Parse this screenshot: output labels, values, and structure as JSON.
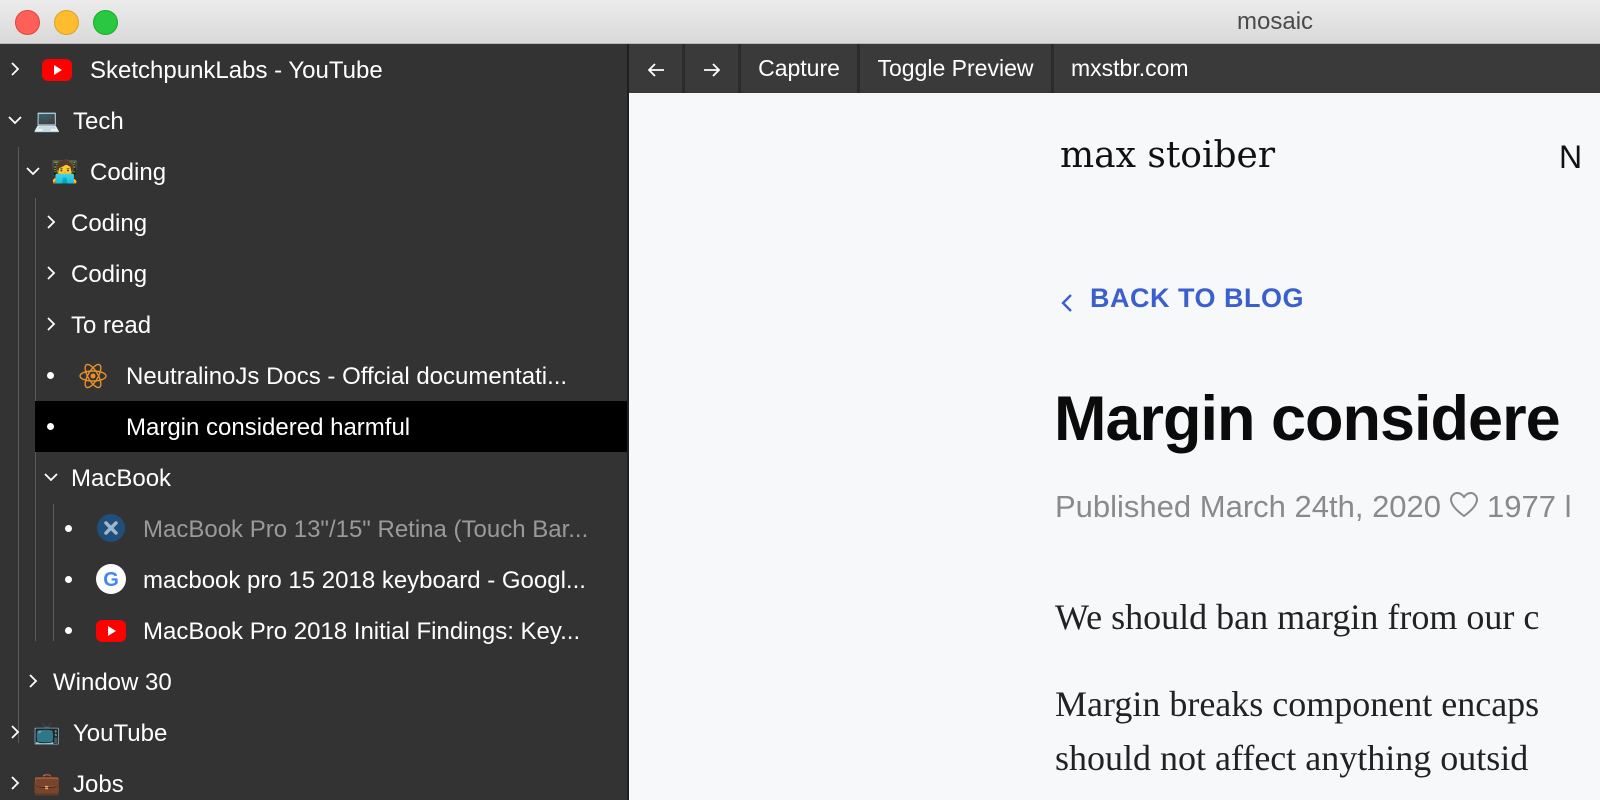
{
  "window": {
    "title": "mosaic"
  },
  "toolbar": {
    "back_icon": "arrow-left-icon",
    "forward_icon": "arrow-right-icon",
    "capture_label": "Capture",
    "toggle_preview_label": "Toggle Preview",
    "url": "mxstbr.com"
  },
  "sidebar": {
    "items": [
      {
        "label": "SketchpunkLabs - YouTube",
        "icon": "youtube-icon",
        "state": "collapsed"
      },
      {
        "label": "Tech",
        "icon": "laptop-emoji",
        "state": "expanded"
      },
      {
        "label": "Coding",
        "icon": "coder-emoji",
        "state": "expanded"
      },
      {
        "label": "Coding",
        "state": "collapsed"
      },
      {
        "label": "Coding",
        "state": "collapsed"
      },
      {
        "label": "To read",
        "state": "collapsed"
      },
      {
        "label": "NeutralinoJs Docs - Offcial documentati...",
        "icon": "atom-icon",
        "state": "leaf"
      },
      {
        "label": "Margin considered harmful",
        "state": "leaf",
        "selected": true
      },
      {
        "label": "MacBook",
        "state": "expanded"
      },
      {
        "label": "MacBook Pro 13\"/15\" Retina (Touch Bar...",
        "icon": "ifixit-icon",
        "state": "leaf",
        "dimmed": true
      },
      {
        "label": "macbook pro 15 2018 keyboard - Googl...",
        "icon": "google-icon",
        "state": "leaf"
      },
      {
        "label": "MacBook Pro 2018 Initial Findings: Key...",
        "icon": "youtube-icon",
        "state": "leaf"
      },
      {
        "label": "Window 30",
        "state": "collapsed"
      },
      {
        "label": "YouTube",
        "icon": "tv-emoji",
        "state": "collapsed"
      },
      {
        "label": "Jobs",
        "icon": "briefcase-emoji",
        "state": "collapsed"
      }
    ]
  },
  "page": {
    "brand": "max stoiber",
    "nav_partial": "N",
    "back_link": "BACK TO BLOG",
    "title": "Margin considere",
    "published": "Published March 24th, 2020",
    "likes": "1977 l",
    "paragraph1": "We should ban margin from our c",
    "paragraph2_line1": "Margin breaks component encaps",
    "paragraph2_line2": "should not affect anything outsid"
  },
  "colors": {
    "sidebar_bg": "#333333",
    "selected_bg": "#000000",
    "link_blue": "#3b5fcc",
    "page_bg": "#f7f8fa"
  }
}
